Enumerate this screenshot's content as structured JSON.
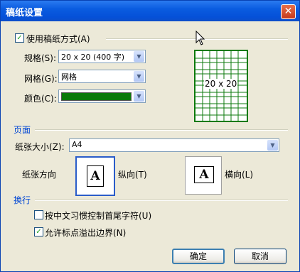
{
  "window": {
    "title": "稿纸设置",
    "close_glyph": "✕"
  },
  "use_grid_paper": {
    "label": "使用稿纸方式(A)",
    "checked": true
  },
  "specs": {
    "label": "规格(S):",
    "value": "20 x 20 (400 字)"
  },
  "grid_type": {
    "label": "网格(G):",
    "value": "网格"
  },
  "color": {
    "label": "颜色(C):",
    "value": "#0a7a0a"
  },
  "preview": {
    "text": "20 x 20"
  },
  "page_section": {
    "title": "页面",
    "paper_size": {
      "label": "纸张大小(Z):",
      "value": "A4"
    },
    "orientation": {
      "label": "纸张方向",
      "portrait": "纵向(T)",
      "landscape": "横向(L)",
      "selected": "portrait",
      "glyph": "A"
    }
  },
  "line_break_section": {
    "title": "换行",
    "chinese_control": {
      "label": "按中文习惯控制首尾字符(U)",
      "checked": false
    },
    "allow_punct": {
      "label": "允许标点溢出边界(N)",
      "checked": true
    }
  },
  "buttons": {
    "ok": "确定",
    "cancel": "取消"
  }
}
